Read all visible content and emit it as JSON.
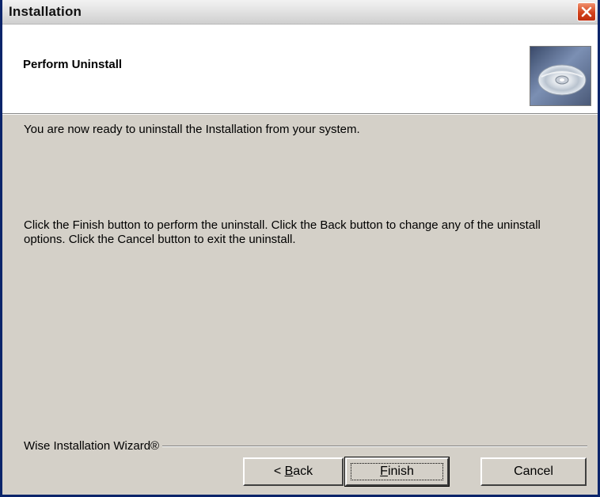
{
  "window": {
    "title": "Installation"
  },
  "header": {
    "title": "Perform Uninstall",
    "image_icon": "cd-disc-icon"
  },
  "content": {
    "line1": "You are now ready to uninstall the  Installation from your system.",
    "line2": "Click the Finish button to perform the uninstall. Click the Back button to change any of the uninstall options. Click the Cancel button to exit the uninstall."
  },
  "footer": {
    "brand": "Wise Installation Wizard®",
    "back": {
      "lt": "< ",
      "mnemonic": "B",
      "rest": "ack"
    },
    "finish": {
      "mnemonic": "F",
      "rest": "inish"
    },
    "cancel": "Cancel"
  },
  "colors": {
    "dialog_bg": "#d4d0c8",
    "close_button": "#d2431c",
    "frame_border": "#0a246a"
  }
}
